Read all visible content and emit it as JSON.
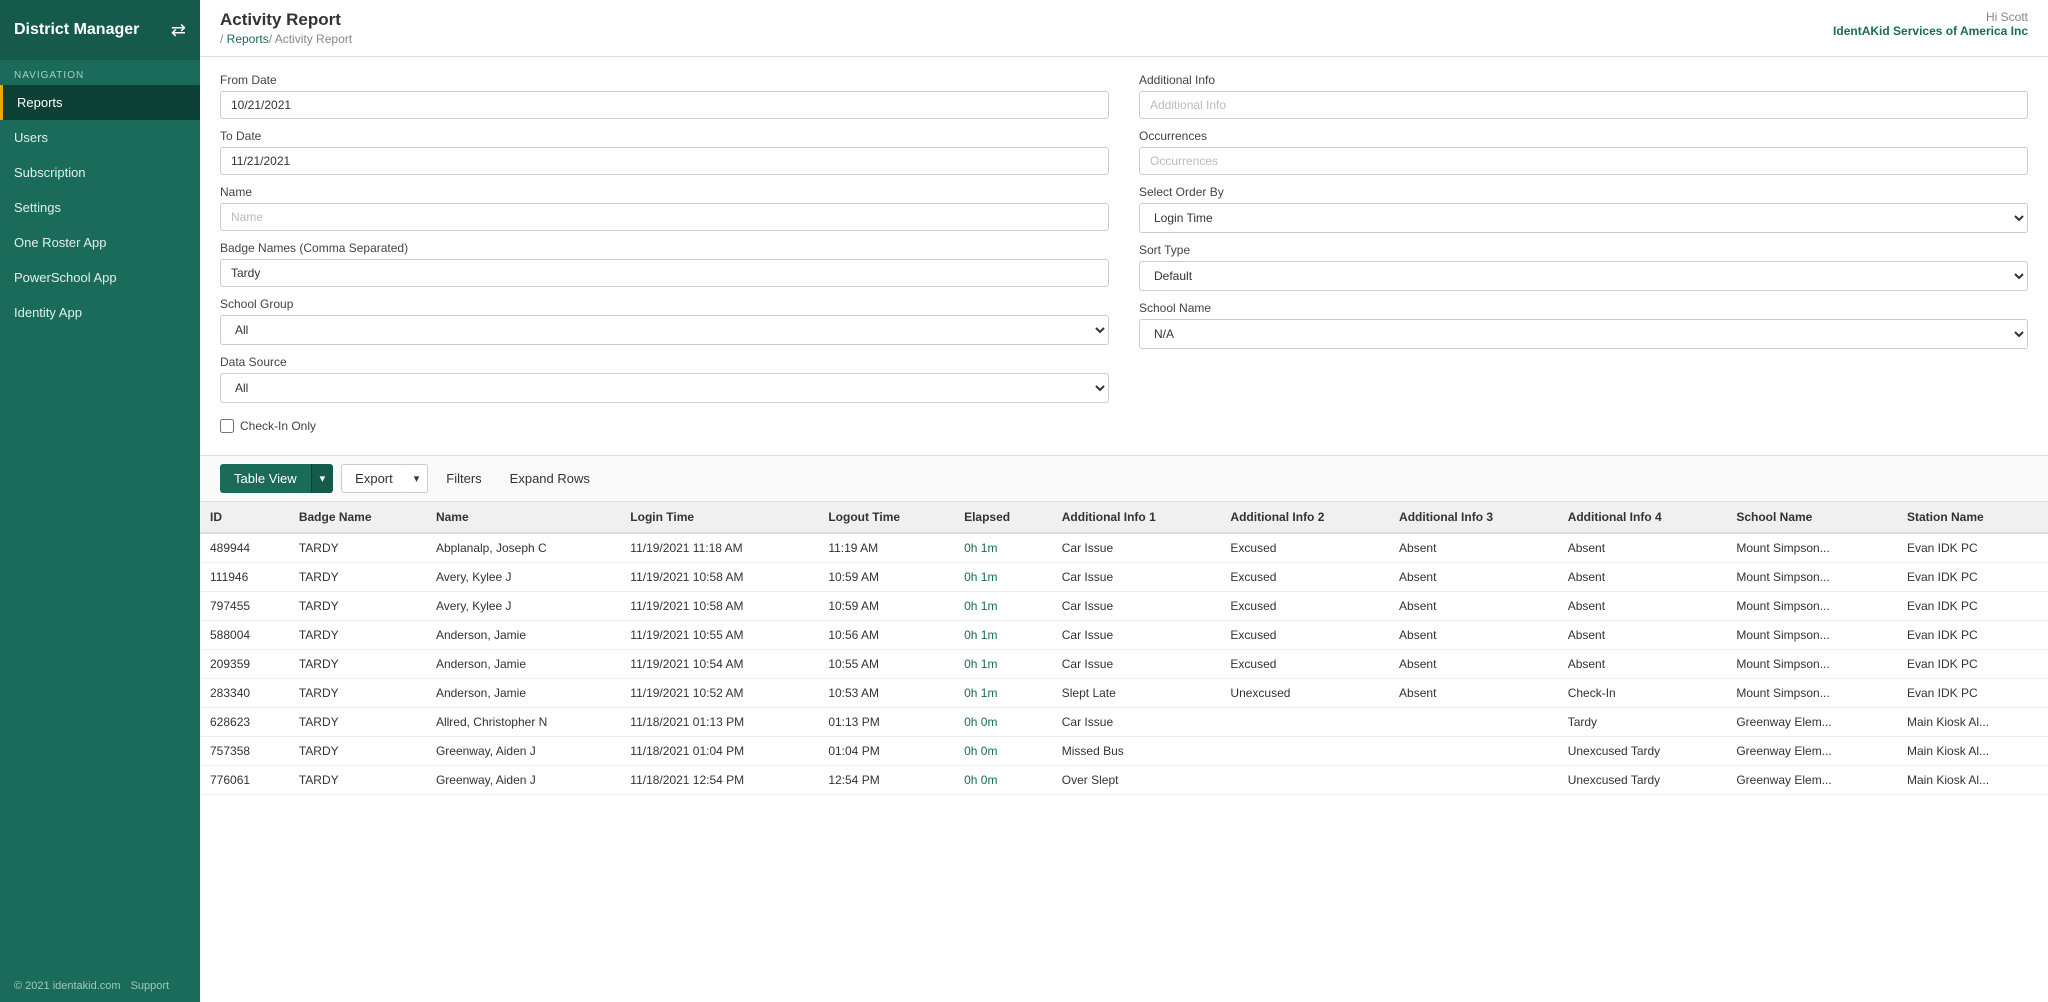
{
  "sidebar": {
    "title": "District Manager",
    "icon": "⇄",
    "nav_label": "NAVIGATION",
    "items": [
      {
        "id": "reports",
        "label": "Reports",
        "active": true
      },
      {
        "id": "users",
        "label": "Users",
        "active": false
      },
      {
        "id": "subscription",
        "label": "Subscription",
        "active": false
      },
      {
        "id": "settings",
        "label": "Settings",
        "active": false
      },
      {
        "id": "one-roster-app",
        "label": "One Roster App",
        "active": false
      },
      {
        "id": "powerschool-app",
        "label": "PowerSchool App",
        "active": false
      },
      {
        "id": "identity-app",
        "label": "Identity App",
        "active": false
      }
    ],
    "footer": {
      "copyright": "© 2021 identakid.com",
      "support": "Support"
    }
  },
  "topbar": {
    "page_title": "Activity Report",
    "breadcrumb_root": "Reports",
    "breadcrumb_current": "Activity Report",
    "breadcrumb_separator": "/ ",
    "user_greeting": "Hi Scott",
    "user_company": "IdentAKid Services of America Inc"
  },
  "filters": {
    "from_date_label": "From Date",
    "from_date_value": "10/21/2021",
    "to_date_label": "To Date",
    "to_date_value": "11/21/2021",
    "name_label": "Name",
    "name_placeholder": "Name",
    "badge_names_label": "Badge Names (Comma Separated)",
    "badge_names_value": "Tardy",
    "school_group_label": "School Group",
    "school_group_value": "All",
    "school_group_options": [
      "All"
    ],
    "data_source_label": "Data Source",
    "data_source_value": "All",
    "data_source_options": [
      "All"
    ],
    "additional_info_label": "Additional Info",
    "additional_info_placeholder": "Additional Info",
    "occurrences_label": "Occurrences",
    "occurrences_placeholder": "Occurrences",
    "select_order_by_label": "Select Order By",
    "select_order_by_value": "Login Time",
    "select_order_by_options": [
      "Login Time"
    ],
    "sort_type_label": "Sort Type",
    "sort_type_value": "Default",
    "sort_type_options": [
      "Default"
    ],
    "school_name_label": "School Name",
    "school_name_value": "N/A",
    "school_name_options": [
      "N/A"
    ],
    "check_in_only_label": "Check-In Only"
  },
  "toolbar": {
    "table_view_label": "Table View",
    "export_label": "Export",
    "filters_label": "Filters",
    "expand_rows_label": "Expand Rows",
    "dropdown_arrow": "▾"
  },
  "table": {
    "columns": [
      "ID",
      "Badge Name",
      "Name",
      "Login Time",
      "Logout Time",
      "Elapsed",
      "Additional Info 1",
      "Additional Info 2",
      "Additional Info 3",
      "Additional Info 4",
      "School Name",
      "Station Name"
    ],
    "rows": [
      {
        "id": "489944",
        "badge": "TARDY",
        "name": "Abplanalp, Joseph C",
        "login": "11/19/2021 11:18 AM",
        "logout": "11:19 AM",
        "elapsed": "0h 1m",
        "ai1": "Car Issue",
        "ai2": "Excused",
        "ai3": "Absent",
        "ai4": "Absent",
        "school": "Mount Simpson...",
        "station": "Evan IDK PC"
      },
      {
        "id": "111946",
        "badge": "TARDY",
        "name": "Avery, Kylee J",
        "login": "11/19/2021 10:58 AM",
        "logout": "10:59 AM",
        "elapsed": "0h 1m",
        "ai1": "Car Issue",
        "ai2": "Excused",
        "ai3": "Absent",
        "ai4": "Absent",
        "school": "Mount Simpson...",
        "station": "Evan IDK PC"
      },
      {
        "id": "797455",
        "badge": "TARDY",
        "name": "Avery, Kylee J",
        "login": "11/19/2021 10:58 AM",
        "logout": "10:59 AM",
        "elapsed": "0h 1m",
        "ai1": "Car Issue",
        "ai2": "Excused",
        "ai3": "Absent",
        "ai4": "Absent",
        "school": "Mount Simpson...",
        "station": "Evan IDK PC"
      },
      {
        "id": "588004",
        "badge": "TARDY",
        "name": "Anderson, Jamie",
        "login": "11/19/2021 10:55 AM",
        "logout": "10:56 AM",
        "elapsed": "0h 1m",
        "ai1": "Car Issue",
        "ai2": "Excused",
        "ai3": "Absent",
        "ai4": "Absent",
        "school": "Mount Simpson...",
        "station": "Evan IDK PC"
      },
      {
        "id": "209359",
        "badge": "TARDY",
        "name": "Anderson, Jamie",
        "login": "11/19/2021 10:54 AM",
        "logout": "10:55 AM",
        "elapsed": "0h 1m",
        "ai1": "Car Issue",
        "ai2": "Excused",
        "ai3": "Absent",
        "ai4": "Absent",
        "school": "Mount Simpson...",
        "station": "Evan IDK PC"
      },
      {
        "id": "283340",
        "badge": "TARDY",
        "name": "Anderson, Jamie",
        "login": "11/19/2021 10:52 AM",
        "logout": "10:53 AM",
        "elapsed": "0h 1m",
        "ai1": "Slept Late",
        "ai2": "Unexcused",
        "ai3": "Absent",
        "ai4": "Check-In",
        "school": "Mount Simpson...",
        "station": "Evan IDK PC"
      },
      {
        "id": "628623",
        "badge": "TARDY",
        "name": "Allred, Christopher N",
        "login": "11/18/2021 01:13 PM",
        "logout": "01:13 PM",
        "elapsed": "0h 0m",
        "ai1": "Car Issue",
        "ai2": "",
        "ai3": "",
        "ai4": "Tardy",
        "school": "Greenway Elem...",
        "station": "Main Kiosk Al..."
      },
      {
        "id": "757358",
        "badge": "TARDY",
        "name": "Greenway, Aiden J",
        "login": "11/18/2021 01:04 PM",
        "logout": "01:04 PM",
        "elapsed": "0h 0m",
        "ai1": "Missed Bus",
        "ai2": "",
        "ai3": "",
        "ai4": "Unexcused Tardy",
        "school": "Greenway Elem...",
        "station": "Main Kiosk Al..."
      },
      {
        "id": "776061",
        "badge": "TARDY",
        "name": "Greenway, Aiden J",
        "login": "11/18/2021 12:54 PM",
        "logout": "12:54 PM",
        "elapsed": "0h 0m",
        "ai1": "Over Slept",
        "ai2": "",
        "ai3": "",
        "ai4": "Unexcused Tardy",
        "school": "Greenway Elem...",
        "station": "Main Kiosk Al..."
      }
    ]
  }
}
